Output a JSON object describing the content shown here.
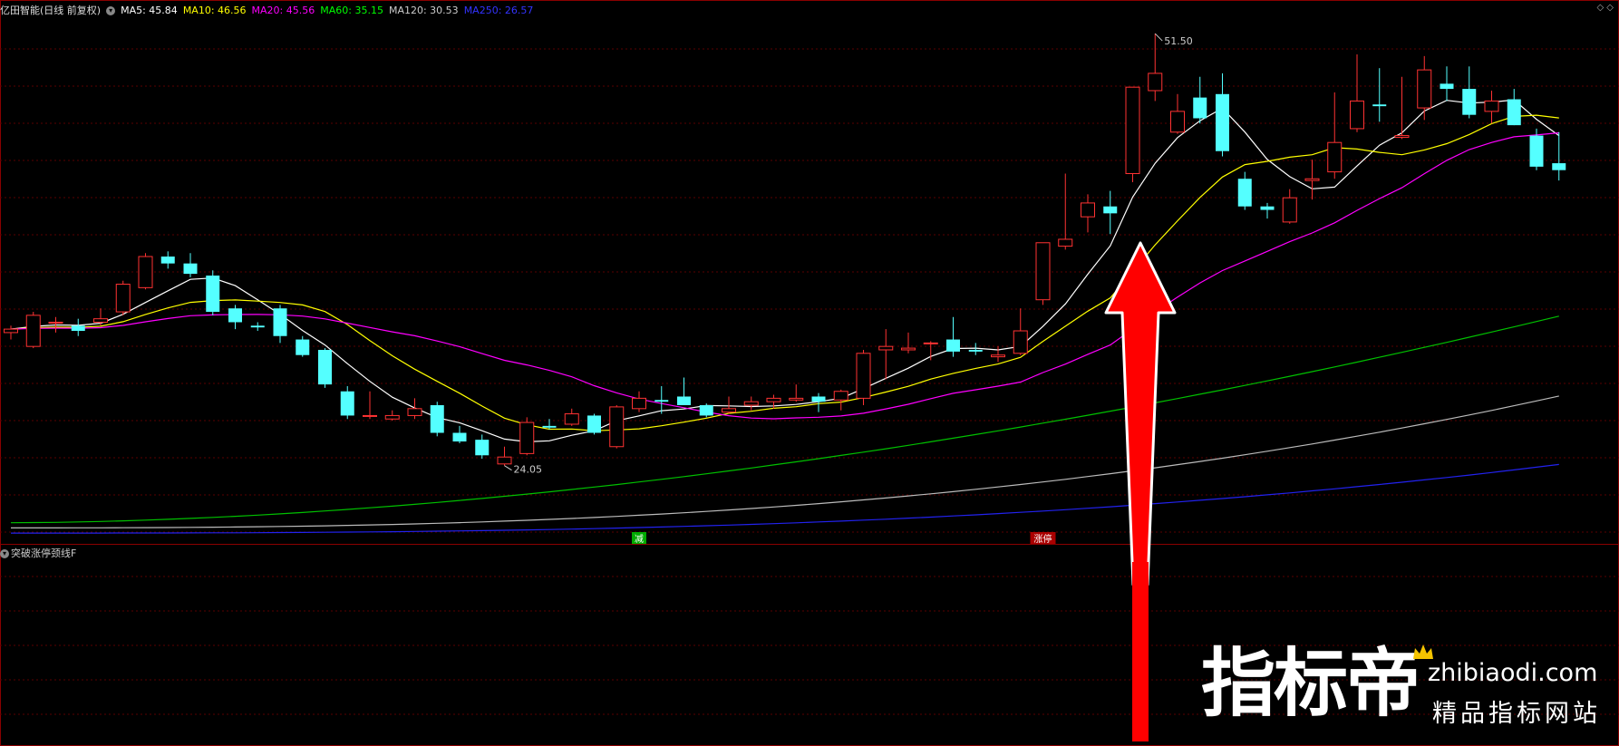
{
  "header": {
    "title": "亿田智能(日线 前复权)",
    "ma": [
      {
        "label": "MA5: 45.84",
        "color": "#ffffff"
      },
      {
        "label": "MA10: 46.56",
        "color": "#ffff00"
      },
      {
        "label": "MA20: 45.56",
        "color": "#ff00ff"
      },
      {
        "label": "MA60: 35.15",
        "color": "#00ff00"
      },
      {
        "label": "MA120: 30.53",
        "color": "#cccccc"
      },
      {
        "label": "MA250: 26.57",
        "color": "#3333ff"
      }
    ]
  },
  "indicator": {
    "name": "突破涨停颈线F"
  },
  "chart_data": {
    "type": "candlestick",
    "price_range": [
      22.5,
      52.5
    ],
    "high_label": "51.50",
    "low_label": "24.05",
    "markers": [
      {
        "text": "减",
        "index": 28,
        "color": "#00aa00"
      },
      {
        "text": "涨停",
        "index": 46,
        "color": "#aa0000"
      }
    ],
    "candles": [
      [
        34.2,
        34.6,
        33.8,
        34.4
      ],
      [
        33.4,
        35.4,
        33.3,
        35.2
      ],
      [
        34.8,
        35.1,
        34.2,
        34.8
      ],
      [
        34.6,
        35.0,
        34.0,
        34.3
      ],
      [
        34.8,
        35.6,
        34.6,
        35.0
      ],
      [
        35.4,
        37.2,
        35.2,
        37.0
      ],
      [
        36.8,
        38.8,
        36.7,
        38.6
      ],
      [
        38.6,
        38.9,
        37.9,
        38.2
      ],
      [
        38.2,
        38.8,
        37.4,
        37.6
      ],
      [
        37.5,
        37.8,
        35.2,
        35.4
      ],
      [
        35.6,
        35.8,
        34.4,
        34.8
      ],
      [
        34.6,
        34.8,
        34.3,
        34.5
      ],
      [
        35.6,
        35.8,
        33.6,
        34.0
      ],
      [
        33.8,
        34.0,
        32.8,
        32.9
      ],
      [
        33.2,
        33.3,
        31.0,
        31.2
      ],
      [
        30.8,
        31.1,
        29.2,
        29.4
      ],
      [
        29.4,
        30.8,
        29.2,
        29.4
      ],
      [
        29.2,
        29.7,
        29.1,
        29.4
      ],
      [
        29.4,
        30.4,
        29.2,
        29.8
      ],
      [
        30.0,
        30.2,
        28.2,
        28.4
      ],
      [
        28.4,
        28.8,
        27.8,
        27.9
      ],
      [
        28.0,
        28.3,
        26.9,
        27.1
      ],
      [
        26.6,
        27.6,
        26.5,
        27.0
      ],
      [
        27.2,
        29.3,
        27.1,
        29.0
      ],
      [
        28.8,
        29.2,
        28.6,
        28.7
      ],
      [
        28.9,
        29.8,
        28.8,
        29.5
      ],
      [
        29.4,
        29.5,
        28.3,
        28.4
      ],
      [
        27.6,
        30.0,
        27.5,
        29.9
      ],
      [
        29.8,
        30.8,
        29.6,
        30.4
      ],
      [
        30.3,
        31.1,
        29.5,
        30.2
      ],
      [
        30.5,
        31.6,
        30.1,
        30.0
      ],
      [
        30.0,
        30.1,
        29.3,
        29.4
      ],
      [
        29.6,
        30.5,
        29.5,
        29.8
      ],
      [
        30.0,
        30.5,
        29.7,
        30.2
      ],
      [
        30.2,
        30.6,
        29.8,
        30.4
      ],
      [
        30.3,
        31.2,
        30.2,
        30.4
      ],
      [
        30.5,
        30.7,
        29.6,
        30.2
      ],
      [
        30.3,
        30.9,
        29.7,
        30.8
      ],
      [
        30.4,
        33.2,
        30.0,
        33.0
      ],
      [
        33.2,
        34.4,
        31.5,
        33.4
      ],
      [
        33.2,
        34.2,
        33.0,
        33.3
      ],
      [
        33.6,
        33.7,
        32.6,
        33.6
      ],
      [
        33.8,
        35.1,
        32.8,
        33.1
      ],
      [
        33.2,
        33.6,
        32.9,
        33.1
      ],
      [
        32.8,
        33.4,
        32.5,
        32.9
      ],
      [
        33.0,
        35.6,
        32.9,
        34.3
      ],
      [
        36.1,
        39.4,
        35.8,
        39.4
      ],
      [
        39.2,
        43.4,
        39.0,
        39.6
      ],
      [
        40.9,
        42.2,
        40.0,
        41.7
      ],
      [
        41.5,
        42.4,
        39.9,
        41.1
      ],
      [
        43.4,
        48.4,
        42.9,
        48.4
      ],
      [
        48.2,
        51.5,
        47.6,
        49.2
      ],
      [
        45.8,
        48.0,
        45.7,
        47.0
      ],
      [
        47.8,
        49.0,
        46.3,
        46.6
      ],
      [
        48.0,
        49.2,
        44.4,
        44.7
      ],
      [
        43.1,
        43.5,
        41.3,
        41.5
      ],
      [
        41.5,
        41.7,
        40.8,
        41.3
      ],
      [
        40.6,
        42.5,
        40.5,
        42.0
      ],
      [
        43.0,
        44.2,
        41.9,
        43.1
      ],
      [
        43.5,
        48.1,
        43.1,
        45.2
      ],
      [
        46.0,
        50.3,
        45.8,
        47.6
      ],
      [
        47.4,
        49.5,
        46.4,
        47.3
      ],
      [
        45.5,
        49.0,
        45.4,
        45.6
      ],
      [
        47.2,
        50.2,
        46.5,
        49.4
      ],
      [
        48.6,
        49.6,
        47.6,
        48.3
      ],
      [
        48.3,
        49.6,
        46.6,
        46.8
      ],
      [
        47.0,
        48.2,
        46.3,
        47.6
      ],
      [
        47.7,
        48.3,
        46.2,
        46.2
      ],
      [
        45.6,
        46.0,
        43.6,
        43.8
      ],
      [
        44.0,
        45.8,
        43.0,
        43.6
      ]
    ]
  }
}
